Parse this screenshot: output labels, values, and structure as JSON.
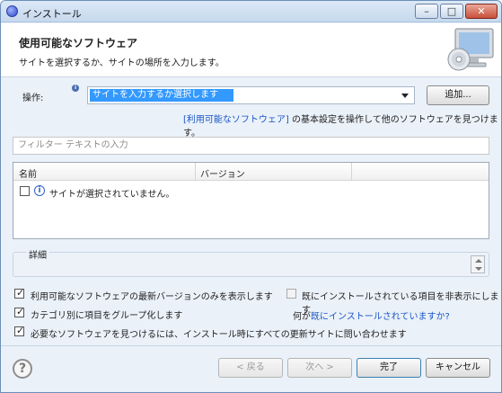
{
  "window": {
    "title": "インストール"
  },
  "titlebar_buttons": {
    "minimize": "–",
    "maximize": "□",
    "close": "✕"
  },
  "header": {
    "title": "使用可能なソフトウェア",
    "description": "サイトを選択するか、サイトの場所を入力します。"
  },
  "operation": {
    "label": "操作:",
    "info_icon": "i",
    "selected_value": "サイトを入力するか選択します",
    "add_button": "追加..."
  },
  "prefs_link": {
    "link_text": "[利用可能なソフトウェア]",
    "rest_text": " の基本設定を操作して他のソフトウェアを見つけます。"
  },
  "filter": {
    "placeholder": "フィルター テキストの入力"
  },
  "table": {
    "columns": [
      "名前",
      "バージョン"
    ],
    "rows": [
      {
        "checked": false,
        "icon": "info-icon",
        "text": "サイトが選択されていません。"
      }
    ]
  },
  "details": {
    "title": "詳細"
  },
  "options": {
    "latest_only": {
      "label": "利用可能なソフトウェアの最新バージョンのみを表示します",
      "checked": true
    },
    "group_by_category": {
      "label": "カテゴリ別に項目をグループ化します",
      "checked": true
    },
    "contact_all_sites": {
      "label": "必要なソフトウェアを見つけるには、インストール時にすべての更新サイトに問い合わせます",
      "checked": true
    },
    "hide_installed": {
      "label": "既にインストールされている項目を非表示にします",
      "checked": false
    },
    "whats_installed_prefix": "何が",
    "whats_installed_link": "既にインストールされていますか?"
  },
  "footer": {
    "help_icon": "?",
    "back": "< 戻る",
    "next": "次へ >",
    "finish": "完了",
    "cancel": "キャンセル"
  },
  "colors": {
    "selection": "#3399ff",
    "link": "#1a55c8",
    "dialog_bg": "#eaf1f9"
  }
}
